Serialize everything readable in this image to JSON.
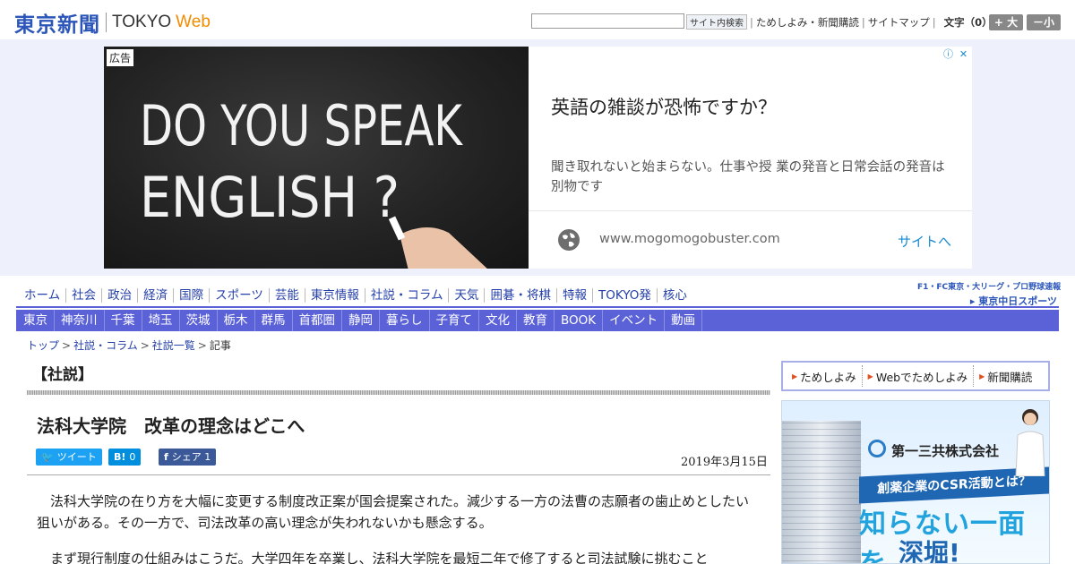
{
  "header": {
    "logo_jp": "東京新聞",
    "logo_tokyo": "TOKYO",
    "logo_web": "Web",
    "search_placeholder": "",
    "search_button": "サイト内検索",
    "links": [
      "ためしよみ・新聞購読",
      "サイトマップ"
    ],
    "font_size_label": "文字（0）",
    "font_large": "+ 大",
    "font_small": "－小"
  },
  "ad": {
    "badge": "広告",
    "chalk_line1": "DO YOU SPEAK",
    "chalk_line2": "ENGLISH ?",
    "headline": "英語の雑談が恐怖ですか？",
    "description": "聞き取れないと始まらない。仕事や授 業の発音と日常会話の発音は別物です",
    "url": "www.mogomogobuster.com",
    "cta": "サイトへ",
    "info_icon": "info-icon",
    "close_icon": "close-icon",
    "globe_icon": "globe-icon"
  },
  "nav_main": [
    "ホーム",
    "社会",
    "政治",
    "経済",
    "国際",
    "スポーツ",
    "芸能",
    "東京情報",
    "社説・コラム",
    "天気",
    "囲碁・将棋",
    "特報",
    "TOKYO発",
    "核心"
  ],
  "chunichi": {
    "small": "F1・FC東京・大リーグ・プロ野球速報",
    "title": "東京中日スポーツ"
  },
  "nav_region": [
    "東京",
    "神奈川",
    "千葉",
    "埼玉",
    "茨城",
    "栃木",
    "群馬",
    "首都圏",
    "静岡",
    "暮らし",
    "子育て",
    "文化",
    "教育",
    "BOOK",
    "イベント",
    "動画"
  ],
  "breadcrumb": [
    "トップ",
    "社説・コラム",
    "社説一覧",
    "記事"
  ],
  "article": {
    "section": "【社説】",
    "title": "法科大学院　改革の理念はどこへ",
    "share_tweet": "ツイート",
    "share_hatena": "0",
    "share_hatena_icon": "B!",
    "share_fb": "シェア 1",
    "date": "2019年3月15日",
    "p1": "　法科大学院の在り方を大幅に変更する制度改正案が国会提案された。減少する一方の法曹の志願者の歯止めとしたい狙いがある。その一方で、司法改革の高い理念が失われないかも懸念する。",
    "p2": "　まず現行制度の仕組みはこうだ。大学四年を卒業し、法科大学院を最短二年で修了すると司法試験に挑むこと"
  },
  "sidebar": {
    "buttons": [
      "ためしよみ",
      "Webでためしよみ",
      "新聞購読"
    ],
    "ad_company": "第一三共株式会社",
    "ad_banner": "創薬企業のCSR活動とは？",
    "ad_big1": "知らない一面を",
    "ad_big2": "深堀!"
  },
  "colors": {
    "brand_blue": "#2b55b9",
    "web_orange": "#f08c00",
    "nav_purple": "#5b62d8",
    "link_blue": "#2540a8"
  }
}
